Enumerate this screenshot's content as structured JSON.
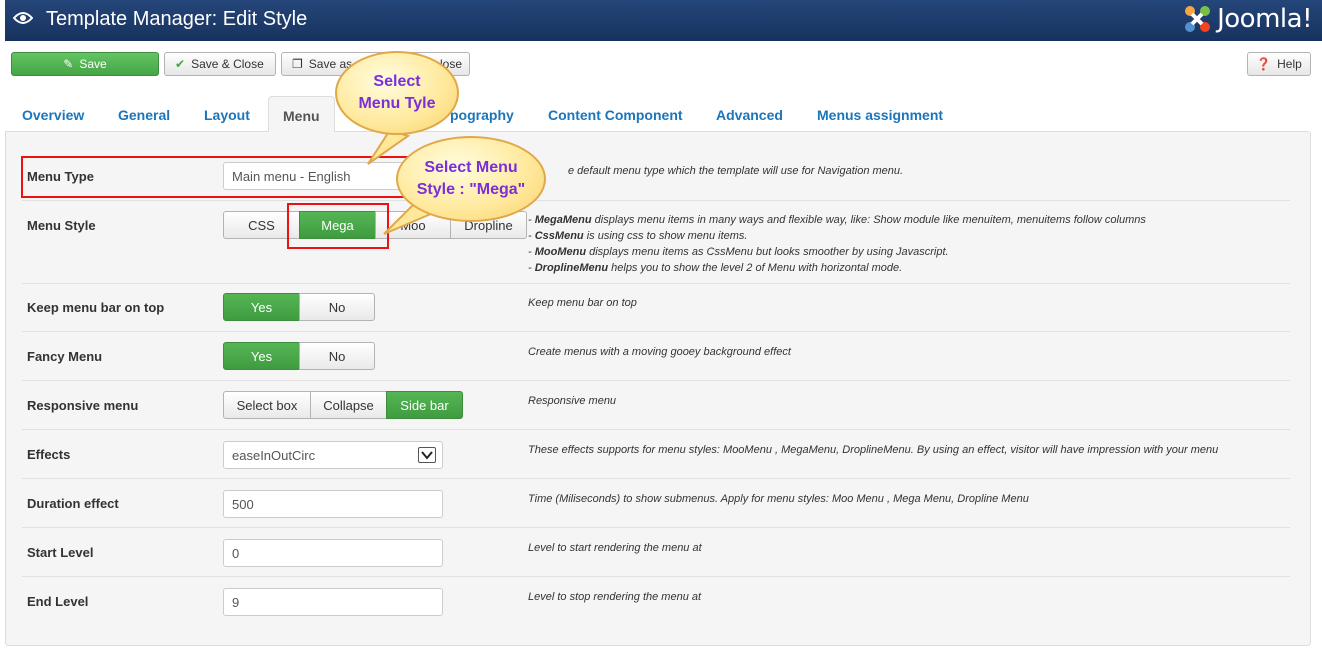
{
  "header": {
    "title": "Template Manager: Edit Style",
    "brand": "Joomla!"
  },
  "toolbar": {
    "save": "Save",
    "save_close": "Save & Close",
    "save_as_copy_part1": "Save as",
    "save_as_copy_part2": "lose",
    "help": "Help"
  },
  "tabs": [
    "Overview",
    "General",
    "Layout",
    "Menu",
    "pography",
    "Content Component",
    "Advanced",
    "Menus assignment"
  ],
  "callouts": {
    "menu_type": "Select Menu Tyle",
    "menu_style": "Select Menu Style : \"Mega\""
  },
  "fields": {
    "menu_type": {
      "label": "Menu Type",
      "value": "Main menu - English",
      "desc": "e default menu type which the template will use for Navigation menu."
    },
    "menu_style": {
      "label": "Menu Style",
      "options": [
        "CSS",
        "Mega",
        "Moo",
        "Dropline"
      ],
      "selected": "Mega",
      "desc": [
        {
          "b": "MegaMenu",
          "t": " displays menu items in many ways and flexible way, like: Show module like menuitem, menuitems follow columns"
        },
        {
          "b": "CssMenu",
          "t": " is using css to show menu items."
        },
        {
          "b": "MooMenu",
          "t": " displays menu items as CssMenu but looks smoother by using Javascript."
        },
        {
          "b": "DroplineMenu",
          "t": " helps you to show the level 2 of Menu with horizontal mode."
        }
      ]
    },
    "keep_top": {
      "label": "Keep menu bar on top",
      "yes": "Yes",
      "no": "No",
      "selected": "Yes",
      "desc": "Keep menu bar on top"
    },
    "fancy": {
      "label": "Fancy Menu",
      "yes": "Yes",
      "no": "No",
      "selected": "Yes",
      "desc": "Create menus with a moving gooey background effect"
    },
    "responsive": {
      "label": "Responsive menu",
      "options": [
        "Select box",
        "Collapse",
        "Side bar"
      ],
      "selected": "Side bar",
      "desc": "Responsive menu"
    },
    "effects": {
      "label": "Effects",
      "value": "easeInOutCirc",
      "desc": "These effects supports for menu styles: MooMenu , MegaMenu, DroplineMenu. By using an effect, visitor will have impression with your menu"
    },
    "duration": {
      "label": "Duration effect",
      "value": "500",
      "desc": "Time (Miliseconds) to show submenus. Apply for menu styles: Moo Menu , Mega Menu, Dropline Menu"
    },
    "start_level": {
      "label": "Start Level",
      "value": "0",
      "desc": "Level to start rendering the menu at"
    },
    "end_level": {
      "label": "End Level",
      "value": "9",
      "desc": "Level to stop rendering the menu at"
    }
  }
}
